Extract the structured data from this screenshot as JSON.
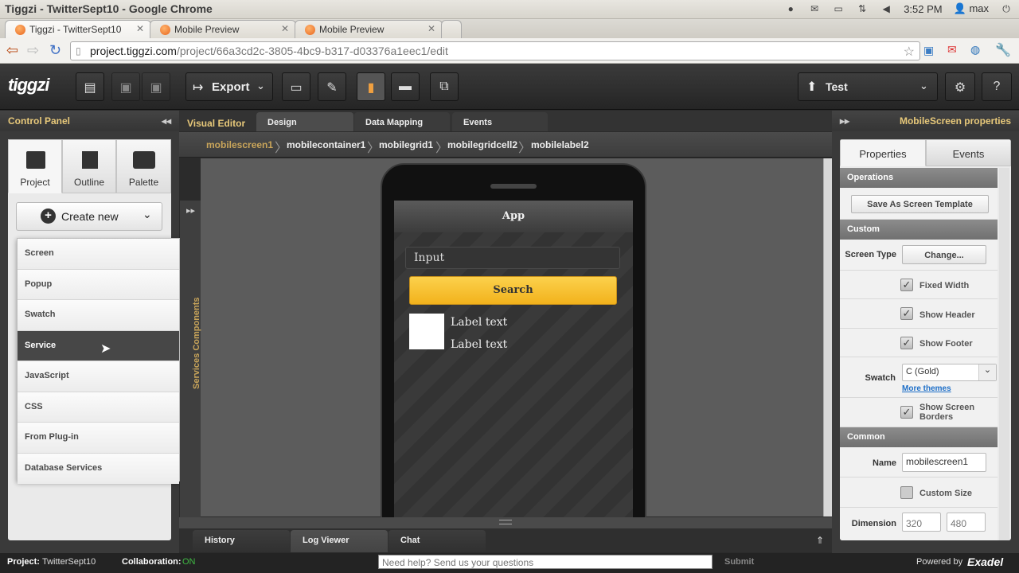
{
  "os": {
    "window_title": "Tiggzi - TwitterSept10 - Google Chrome",
    "clock": "3:52 PM",
    "user": "max"
  },
  "browser": {
    "tabs": [
      {
        "label": "Tiggzi - TwitterSept10"
      },
      {
        "label": "Mobile Preview"
      },
      {
        "label": "Mobile Preview"
      }
    ],
    "url_host": "project.tiggzi.com",
    "url_path": "/project/66a3cd2c-3805-4bc9-b317-d03376a1eec1/edit"
  },
  "toolbar": {
    "logo": "tiggzi",
    "export_label": "Export",
    "test_label": "Test"
  },
  "control_panel": {
    "title": "Control Panel",
    "tabs": [
      {
        "label": "Project"
      },
      {
        "label": "Outline"
      },
      {
        "label": "Palette"
      }
    ],
    "create_new_label": "Create new",
    "menu_items": [
      {
        "label": "Screen"
      },
      {
        "label": "Popup"
      },
      {
        "label": "Swatch"
      },
      {
        "label": "Service"
      },
      {
        "label": "JavaScript"
      },
      {
        "label": "CSS"
      },
      {
        "label": "From Plug-in"
      },
      {
        "label": "Database Services"
      }
    ],
    "selected_item": "Service"
  },
  "side_strip": {
    "label": "Services Components"
  },
  "editor": {
    "tabs": [
      {
        "label": "Visual Editor"
      },
      {
        "label": "Design"
      },
      {
        "label": "Data Mapping"
      },
      {
        "label": "Events"
      }
    ],
    "breadcrumbs": [
      "mobilescreen1",
      "mobilecontainer1",
      "mobilegrid1",
      "mobilegridcell2",
      "mobilelabel2"
    ]
  },
  "phone": {
    "header_title": "App",
    "input_value": "Input",
    "button_label": "Search",
    "labels": [
      "Label text",
      "Label text"
    ]
  },
  "bottom_tabs": [
    {
      "label": "History"
    },
    {
      "label": "Log Viewer"
    },
    {
      "label": "Chat"
    }
  ],
  "properties": {
    "title": "MobileScreen properties",
    "tabs": [
      {
        "label": "Properties"
      },
      {
        "label": "Events"
      }
    ],
    "operations_header": "Operations",
    "save_template_label": "Save As Screen Template",
    "custom_header": "Custom",
    "screen_type_label": "Screen Type",
    "change_label": "Change...",
    "fixed_width_label": "Fixed Width",
    "show_header_label": "Show Header",
    "show_footer_label": "Show Footer",
    "swatch_label": "Swatch",
    "swatch_value": "C (Gold)",
    "more_themes_label": "More themes",
    "show_borders_label": "Show Screen Borders",
    "common_header": "Common",
    "name_label": "Name",
    "name_value": "mobilescreen1",
    "custom_size_label": "Custom Size",
    "dimension_label": "Dimension",
    "width_placeholder": "320",
    "height_placeholder": "480"
  },
  "footer": {
    "project_label": "Project:",
    "project_value": "TwitterSept10",
    "collab_label": "Collaboration:",
    "collab_value": "ON",
    "help_placeholder": "Need help? Send us your questions",
    "submit_label": "Submit",
    "powered_label": "Powered by",
    "brand": "Exadel"
  },
  "colors": {
    "accent_gold": "#e8c97a",
    "search_button": "#f6be2c",
    "collab_on": "#3fb843"
  }
}
